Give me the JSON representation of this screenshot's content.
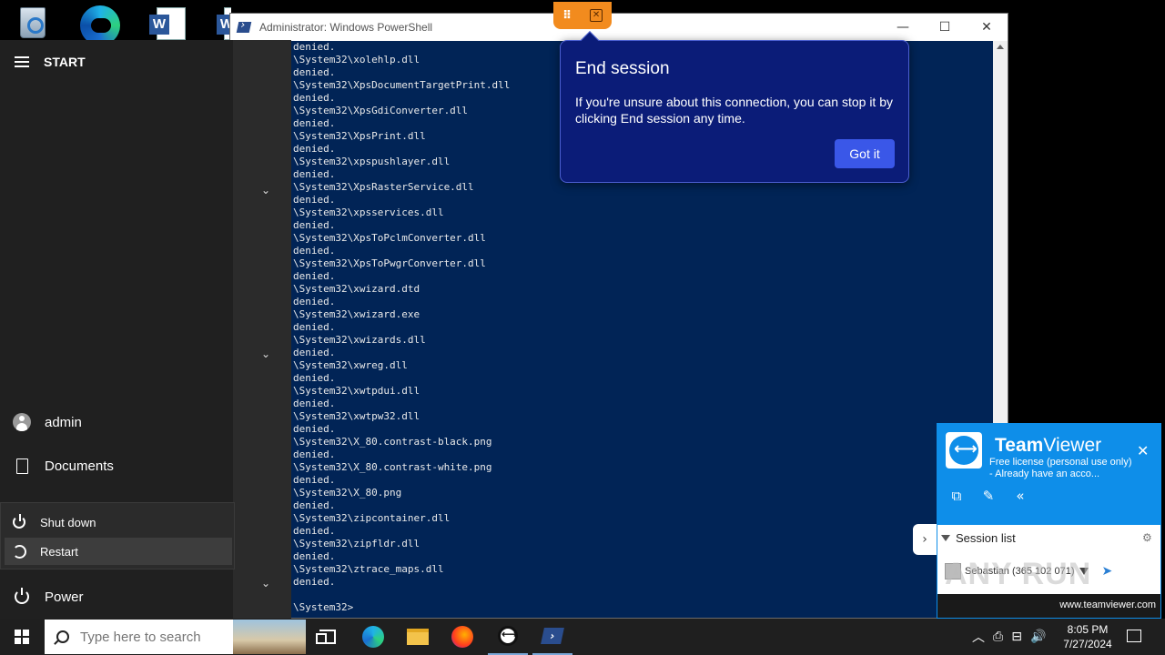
{
  "powershell": {
    "title": "Administrator: Windows PowerShell",
    "controls": {
      "minimize": "—",
      "maximize": "☐",
      "close": "✕"
    },
    "lines": [
      "denied.",
      "\\System32\\xolehlp.dll",
      "denied.",
      "\\System32\\XpsDocumentTargetPrint.dll",
      "denied.",
      "\\System32\\XpsGdiConverter.dll",
      "denied.",
      "\\System32\\XpsPrint.dll",
      "denied.",
      "\\System32\\xpspushlayer.dll",
      "denied.",
      "\\System32\\XpsRasterService.dll",
      "denied.",
      "\\System32\\xpsservices.dll",
      "denied.",
      "\\System32\\XpsToPclmConverter.dll",
      "denied.",
      "\\System32\\XpsToPwgrConverter.dll",
      "denied.",
      "\\System32\\xwizard.dtd",
      "denied.",
      "\\System32\\xwizard.exe",
      "denied.",
      "\\System32\\xwizards.dll",
      "denied.",
      "\\System32\\xwreg.dll",
      "denied.",
      "\\System32\\xwtpdui.dll",
      "denied.",
      "\\System32\\xwtpw32.dll",
      "denied.",
      "\\System32\\X_80.contrast-black.png",
      "denied.",
      "\\System32\\X_80.contrast-white.png",
      "denied.",
      "\\System32\\X_80.png",
      "denied.",
      "\\System32\\zipcontainer.dll",
      "denied.",
      "\\System32\\zipfldr.dll",
      "denied.",
      "\\System32\\ztrace_maps.dll",
      "denied.",
      "",
      "\\System32>"
    ]
  },
  "start_menu": {
    "title": "START",
    "user": "admin",
    "documents": "Documents",
    "power": "Power",
    "power_submenu": {
      "shutdown": "Shut down",
      "restart": "Restart"
    },
    "chevron": "⌄"
  },
  "end_session": {
    "grip": "⠿",
    "close": "✕",
    "title": "End session",
    "text": "If you're unsure about this connection, you can stop it by clicking End session any time.",
    "button": "Got it"
  },
  "teamviewer": {
    "name_bold": "Team",
    "name_regular": "Viewer",
    "license": "Free license (personal use only) - Already have an acco...",
    "close": "✕",
    "actions": [
      "⧉",
      "✎",
      "«"
    ],
    "side_toggle": "›",
    "session_label": "Session list",
    "gear": "⚙",
    "contact": "Sebastian (365 102 071)",
    "cursor": "➤",
    "footer": "www.teamviewer.com",
    "watermark": "ANY RUN"
  },
  "taskbar": {
    "search_placeholder": "Type here to search",
    "tray": [
      "︿",
      "⎙",
      "⊟",
      "🔊"
    ],
    "time": "8:05 PM",
    "date": "7/27/2024"
  }
}
